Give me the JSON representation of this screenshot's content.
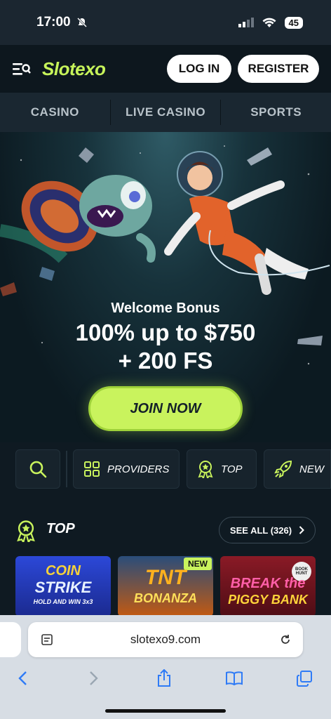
{
  "status_bar": {
    "time": "17:00",
    "battery": "45"
  },
  "header": {
    "logo": "Slotexo",
    "login_label": "LOG IN",
    "register_label": "REGISTER"
  },
  "nav": {
    "tabs": [
      {
        "label": "CASINO"
      },
      {
        "label": "LIVE CASINO"
      },
      {
        "label": "SPORTS"
      }
    ]
  },
  "hero": {
    "subtitle": "Welcome Bonus",
    "headline_1": "100% up to $750",
    "headline_2": "+ 200 FS",
    "cta_label": "JOIN NOW"
  },
  "filters": {
    "providers_label": "PROVIDERS",
    "top_label": "TOP",
    "new_label": "NEW"
  },
  "top_section": {
    "title": "TOP",
    "see_all_label": "SEE ALL (326)"
  },
  "games": [
    {
      "title_1": "COIN",
      "title_2": "STRIKE",
      "tagline": "HOLD AND WIN 3x3",
      "bg": "#2436b8"
    },
    {
      "title_1": "TNT",
      "title_2": "BONANZA",
      "badge": "NEW",
      "bg": "#c25a12"
    },
    {
      "title_1": "BREAK the",
      "title_2": "PIGGY BANK",
      "badge": "BOOK HUNT",
      "bg": "#7a1620"
    }
  ],
  "browser": {
    "url": "slotexo9.com"
  },
  "colors": {
    "accent": "#c9f35d",
    "header_bg": "#0d171e",
    "nav_bg": "#1a2731"
  }
}
